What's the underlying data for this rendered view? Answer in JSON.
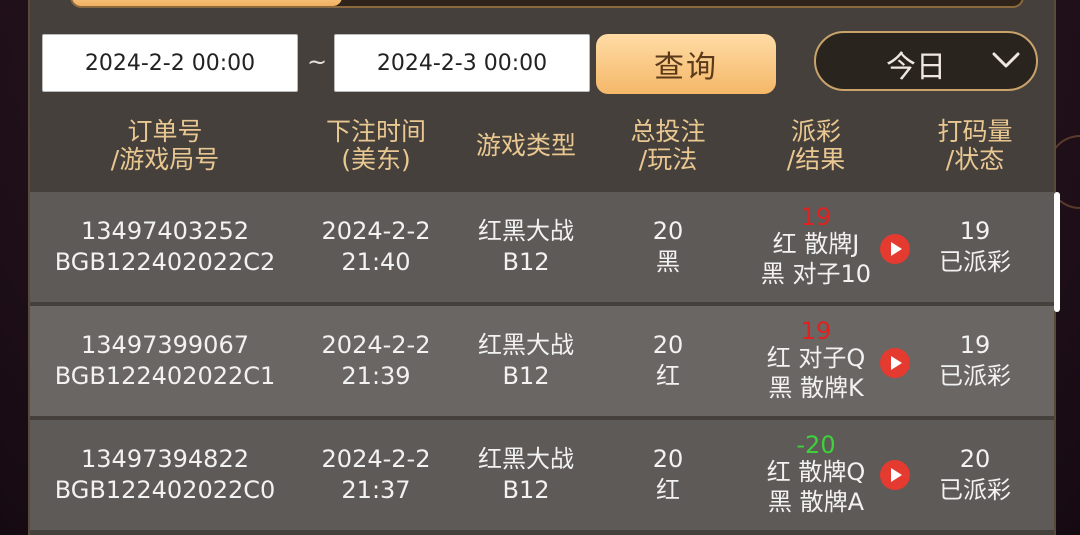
{
  "filters": {
    "start_date": "2024-2-2 00:00",
    "separator": "~",
    "end_date": "2024-2-3 00:00",
    "query_label": "查询",
    "period_label": "今日"
  },
  "headers": {
    "order": [
      "订单号",
      "/游戏局号"
    ],
    "time": [
      "下注时间",
      "(美东)"
    ],
    "game": [
      "游戏类型"
    ],
    "bet": [
      "总投注",
      "/玩法"
    ],
    "payout": [
      "派彩",
      "/结果"
    ],
    "volume": [
      "打码量",
      "/状态"
    ]
  },
  "rows": [
    {
      "order_no": "13497403252",
      "round_no": "BGB122402022C2",
      "date": "2024-2-2",
      "time": "21:40",
      "game_type": "红黑大战",
      "table": "B12",
      "bet_amount": "20",
      "bet_play": "黑",
      "payout": "19",
      "payout_sign": "positive",
      "result_1": "红 散牌J",
      "result_2": "黑 对子10",
      "volume": "19",
      "status": "已派彩"
    },
    {
      "order_no": "13497399067",
      "round_no": "BGB122402022C1",
      "date": "2024-2-2",
      "time": "21:39",
      "game_type": "红黑大战",
      "table": "B12",
      "bet_amount": "20",
      "bet_play": "红",
      "payout": "19",
      "payout_sign": "positive",
      "result_1": "红 对子Q",
      "result_2": "黑 散牌K",
      "volume": "19",
      "status": "已派彩"
    },
    {
      "order_no": "13497394822",
      "round_no": "BGB122402022C0",
      "date": "2024-2-2",
      "time": "21:37",
      "game_type": "红黑大战",
      "table": "B12",
      "bet_amount": "20",
      "bet_play": "红",
      "payout": "-20",
      "payout_sign": "negative",
      "result_1": "红 散牌Q",
      "result_2": "黑 散牌A",
      "volume": "20",
      "status": "已派彩"
    }
  ],
  "icons": {
    "dropdown": "chevron-down-icon",
    "replay": "play-icon"
  },
  "colors": {
    "header_text": "#e9c791",
    "payout_positive": "#e0211f",
    "payout_negative": "#3cd23a",
    "accent_button": "#f4b768"
  }
}
